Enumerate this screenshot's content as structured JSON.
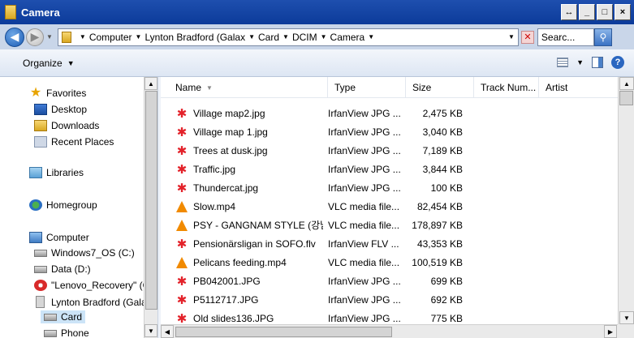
{
  "window": {
    "title": "Camera",
    "buttons": [
      "↔",
      "_",
      "□",
      "×"
    ]
  },
  "address": {
    "breadcrumbs": [
      "Computer",
      "Lynton Bradford (Galax",
      "Card",
      "DCIM",
      "Camera"
    ],
    "search_text": "Searc..."
  },
  "toolbar": {
    "organize_label": "Organize"
  },
  "nav": {
    "favorites": "Favorites",
    "desktop": "Desktop",
    "downloads": "Downloads",
    "recent": "Recent Places",
    "libraries": "Libraries",
    "homegroup": "Homegroup",
    "computer": "Computer",
    "win7": "Windows7_OS (C:)",
    "data": "Data (D:)",
    "lenovo": "\"Lenovo_Recovery\" (C",
    "lynton": "Lynton Bradford (Galax",
    "card": "Card",
    "phone": "Phone"
  },
  "columns": {
    "name": "Name",
    "type": "Type",
    "size": "Size",
    "track": "Track Num...",
    "artist": "Artist"
  },
  "files": [
    {
      "name": "Village map2.jpg",
      "type": "IrfanView JPG ...",
      "size": "2,475 KB",
      "icon": "irfanview-icon"
    },
    {
      "name": "Village map 1.jpg",
      "type": "IrfanView JPG ...",
      "size": "3,040 KB",
      "icon": "irfanview-icon"
    },
    {
      "name": "Trees at dusk.jpg",
      "type": "IrfanView JPG ...",
      "size": "7,189 KB",
      "icon": "irfanview-icon"
    },
    {
      "name": "Traffic.jpg",
      "type": "IrfanView JPG ...",
      "size": "3,844 KB",
      "icon": "irfanview-icon"
    },
    {
      "name": "Thundercat.jpg",
      "type": "IrfanView JPG ...",
      "size": "100 KB",
      "icon": "irfanview-icon"
    },
    {
      "name": "Slow.mp4",
      "type": "VLC media file...",
      "size": "82,454 KB",
      "icon": "vlc-icon"
    },
    {
      "name": "PSY - GANGNAM STYLE (강남...",
      "type": "VLC media file...",
      "size": "178,897 KB",
      "icon": "vlc-icon"
    },
    {
      "name": "Pensionärsligan in SOFO.flv",
      "type": "IrfanView FLV ...",
      "size": "43,353 KB",
      "icon": "irfanview-icon"
    },
    {
      "name": "Pelicans feeding.mp4",
      "type": "VLC media file...",
      "size": "100,519 KB",
      "icon": "vlc-icon"
    },
    {
      "name": "PB042001.JPG",
      "type": "IrfanView JPG ...",
      "size": "699 KB",
      "icon": "irfanview-icon"
    },
    {
      "name": "P5112717.JPG",
      "type": "IrfanView JPG ...",
      "size": "692 KB",
      "icon": "irfanview-icon"
    },
    {
      "name": "Old slides136.JPG",
      "type": "IrfanView JPG ...",
      "size": "775 KB",
      "icon": "irfanview-icon"
    }
  ]
}
